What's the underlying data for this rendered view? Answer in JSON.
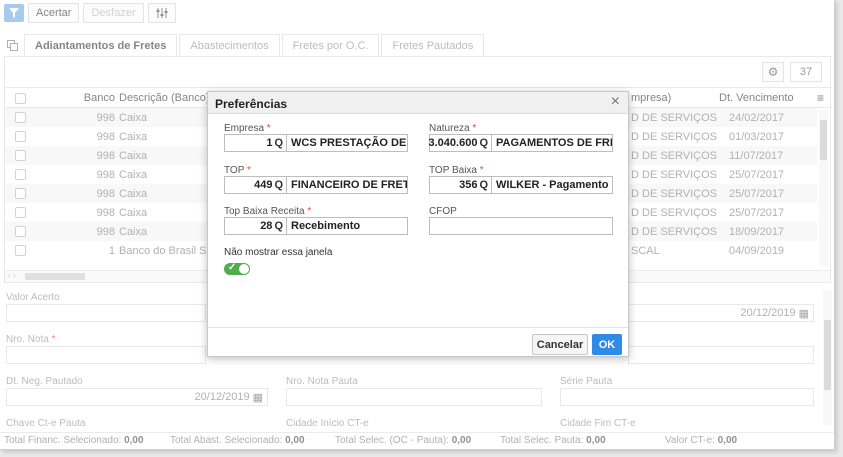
{
  "toolbar": {
    "filter_icon": "filter-icon",
    "acertar_label": "Acertar",
    "desfazer_label": "Desfazer",
    "columns_icon": "column-settings-icon"
  },
  "tabs": [
    {
      "label": "Adiantamentos de Fretes",
      "active": true
    },
    {
      "label": "Abastecimentos",
      "active": false
    },
    {
      "label": "Fretes por O.C.",
      "active": false
    },
    {
      "label": "Fretes Pautados",
      "active": false
    }
  ],
  "grid": {
    "record_count": "37",
    "columns": {
      "banco": "Banco",
      "descricao_banco": "Descrição (Banco)",
      "empresa": "mpresa)",
      "dt_vencimento": "Dt. Vencimento"
    },
    "rows": [
      {
        "banco": "998",
        "descricao": "Caixa",
        "empresa": "D DE SERVIÇOS",
        "vencimento": "24/02/2017"
      },
      {
        "banco": "998",
        "descricao": "Caixa",
        "empresa": "D DE SERVIÇOS",
        "vencimento": "01/03/2017"
      },
      {
        "banco": "998",
        "descricao": "Caixa",
        "empresa": "D DE SERVIÇOS",
        "vencimento": "11/07/2017"
      },
      {
        "banco": "998",
        "descricao": "Caixa",
        "empresa": "D DE SERVIÇOS",
        "vencimento": "25/07/2017"
      },
      {
        "banco": "998",
        "descricao": "Caixa",
        "empresa": "D DE SERVIÇOS",
        "vencimento": "25/07/2017"
      },
      {
        "banco": "998",
        "descricao": "Caixa",
        "empresa": "D DE SERVIÇOS",
        "vencimento": "25/07/2017"
      },
      {
        "banco": "998",
        "descricao": "Caixa",
        "empresa": "D DE SERVIÇOS",
        "vencimento": "18/09/2017"
      },
      {
        "banco": "1",
        "descricao": "Banco do Brasil S.A.",
        "empresa": "SCAL",
        "vencimento": "04/09/2019"
      }
    ]
  },
  "form": {
    "valor_acerto_label": "Valor Acerto",
    "valor_acerto_date": "20/12/2019",
    "nro_nota_label": "Nro. Nota",
    "dt_neg_pautado_label": "Dt. Neg. Pautado",
    "dt_neg_pautado_value": "20/12/2019",
    "nro_nota_pauta_label": "Nro. Nota Pauta",
    "serie_pauta_label": "Série Pauta",
    "chave_cte_label": "Chave Ct-e Pauta",
    "cidade_inicio_label": "Cidade Início CT-e",
    "cidade_fim_label": "Cidade Fim CT-e"
  },
  "status": {
    "financ_label": "Total Financ. Selecionado:",
    "financ_value": "0,00",
    "abast_label": "Total Abast. Selecionado:",
    "abast_value": "0,00",
    "oc_label": "Total Selec. (OC - Pauta):",
    "oc_value": "0,00",
    "pauta_label": "Total Selec. Pauta:",
    "pauta_value": "0,00",
    "cte_label": "Valor CT-e:",
    "cte_value": "0,00"
  },
  "modal": {
    "title": "Preferências",
    "empresa_label": "Empresa",
    "empresa_code": "1",
    "empresa_desc": "WCS PRESTAÇÃO DE SER",
    "natureza_label": "Natureza",
    "natureza_code": "3.040.600",
    "natureza_desc": "PAGAMENTOS DE FRETES",
    "top_label": "TOP",
    "top_code": "449",
    "top_desc": "FINANCEIRO DE FRETE C",
    "top_baixa_label": "TOP Baixa",
    "top_baixa_code": "356",
    "top_baixa_desc": "WILKER - Pagamento Fret",
    "top_baixa_receita_label": "Top Baixa Receita",
    "top_baixa_receita_code": "28",
    "top_baixa_receita_desc": "Recebimento",
    "cfop_label": "CFOP",
    "cfop_value": "",
    "nao_mostrar_label": "Não mostrar essa janela",
    "nao_mostrar_enabled": true,
    "cancel_label": "Cancelar",
    "ok_label": "OK",
    "accent_color": "#2f8be5",
    "toggle_color": "#4cae4c"
  }
}
